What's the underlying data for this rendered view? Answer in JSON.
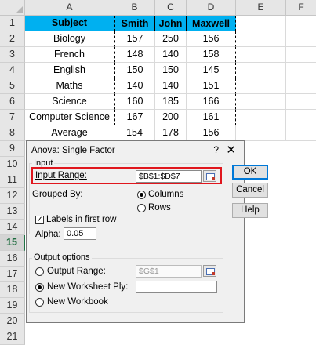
{
  "columns": [
    "A",
    "B",
    "C",
    "D",
    "E",
    "F"
  ],
  "rows": [
    "1",
    "2",
    "3",
    "4",
    "5",
    "6",
    "7",
    "8",
    "9",
    "10",
    "11",
    "12",
    "13",
    "14",
    "15",
    "16",
    "17",
    "18",
    "19",
    "20",
    "21"
  ],
  "table": {
    "headers": [
      "Subject",
      "Smith",
      "John",
      "Maxwell"
    ],
    "data": [
      [
        "Biology",
        "157",
        "250",
        "156"
      ],
      [
        "French",
        "148",
        "140",
        "158"
      ],
      [
        "English",
        "150",
        "150",
        "145"
      ],
      [
        "Maths",
        "140",
        "140",
        "151"
      ],
      [
        "Science",
        "160",
        "185",
        "166"
      ],
      [
        "Computer Science",
        "167",
        "200",
        "161"
      ],
      [
        "Average",
        "154",
        "178",
        "156"
      ]
    ]
  },
  "dialog": {
    "title": "Anova: Single Factor",
    "help": "?",
    "close": "✕",
    "input_section": "Input",
    "input_range_label": "Input Range:",
    "input_range_value": "$B$1:$D$7",
    "grouped_by_label": "Grouped By:",
    "columns_label": "Columns",
    "rows_label": "Rows",
    "labels_first_row": "Labels in first row",
    "labels_checked": "✓",
    "alpha_label": "Alpha:",
    "alpha_value": "0.05",
    "output_section": "Output options",
    "output_range_label": "Output Range:",
    "output_range_value": "$G$1",
    "new_ply_label": "New Worksheet Ply:",
    "new_workbook_label": "New Workbook",
    "ok": "OK",
    "cancel": "Cancel",
    "help_btn": "Help"
  }
}
